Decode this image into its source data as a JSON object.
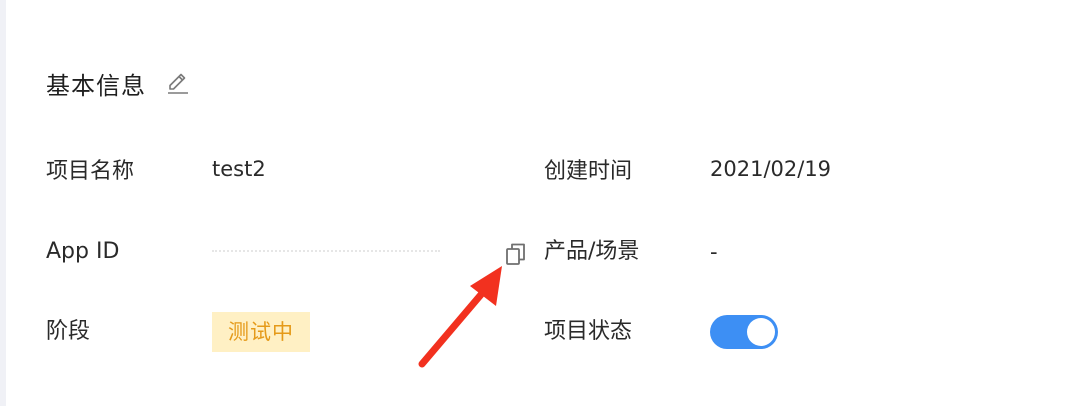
{
  "section": {
    "title": "基本信息"
  },
  "fields": {
    "project_name_label": "项目名称",
    "project_name_value": "test2",
    "app_id_label": "App ID",
    "stage_label": "阶段",
    "stage_value": "测试中",
    "created_time_label": "创建时间",
    "created_time_value": "2021/02/19",
    "product_scene_label": "产品/场景",
    "product_scene_value": "-",
    "project_status_label": "项目状态",
    "project_status_enabled": true
  },
  "icons": {
    "edit": "edit-icon",
    "copy": "copy-icon",
    "annotation": "red-arrow"
  },
  "colors": {
    "badge_bg": "#fff0c4",
    "badge_text": "#e59a19",
    "toggle_on": "#3d8ff4",
    "arrow": "#f2311f"
  }
}
